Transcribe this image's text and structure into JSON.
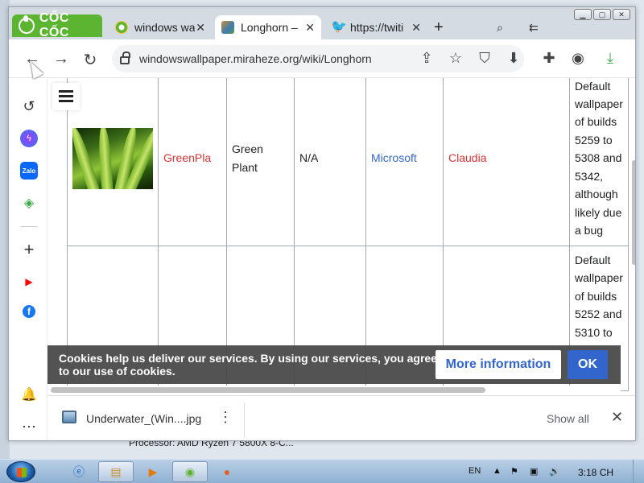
{
  "browser": {
    "brand_text": "CỐC CỐC",
    "tabs": [
      {
        "title": "windows wa",
        "active": false
      },
      {
        "title": "Longhorn –",
        "active": true
      },
      {
        "title": "https://twiti",
        "active": false
      }
    ],
    "address": "windowswallpaper.miraheze.org/wiki/Longhorn"
  },
  "table": {
    "rows": [
      {
        "image_alt": "Green Plant thumbnail",
        "file_link": "GreenPla",
        "name_line1": "Green",
        "name_line2": "Plant",
        "source": "N/A",
        "author": "Microsoft",
        "photographer": "Claudia",
        "notes": [
          "Default",
          "wallpaper",
          "of builds",
          "5259 to",
          "5308 and",
          "5342,",
          "although",
          "likely due",
          "a bug"
        ]
      },
      {
        "notes": [
          "Default",
          "wallpaper",
          "of builds",
          "5252 and",
          "5310 to"
        ]
      }
    ]
  },
  "cookie": {
    "text": "Cookies help us deliver our services. By using our services, you agree to our use of cookies.",
    "more_info": "More information",
    "ok": "OK"
  },
  "downloads": {
    "file_name": "Underwater_(Win....jpg",
    "show_all": "Show all"
  },
  "desktop": {
    "processor_text": "Processor:  AMD Ryzen 7 5800X 8-C..."
  },
  "taskbar": {
    "language": "EN",
    "clock": "3:18 CH"
  },
  "colors": {
    "brand_green": "#5cb531",
    "link_red": "#d33333",
    "link_blue": "#3366cc",
    "accent_blue": "#3366cc"
  }
}
